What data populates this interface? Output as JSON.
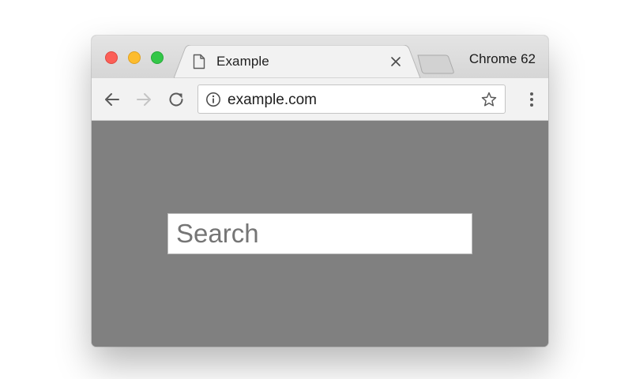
{
  "window": {
    "browser_label": "Chrome 62",
    "tab": {
      "title": "Example",
      "close_glyph": "×"
    }
  },
  "toolbar": {
    "back_icon": "back-arrow-icon",
    "forward_icon": "forward-arrow-icon",
    "reload_icon": "reload-icon",
    "address": {
      "info_icon": "info-icon",
      "url": "example.com",
      "bookmark_icon": "star-icon"
    },
    "menu_icon": "kebab-menu-icon"
  },
  "page": {
    "background_color": "#808080",
    "search": {
      "placeholder": "Search",
      "value": ""
    }
  },
  "colors": {
    "close": "#fc5f57",
    "minimize": "#fdbc2e",
    "maximize": "#33c748"
  }
}
